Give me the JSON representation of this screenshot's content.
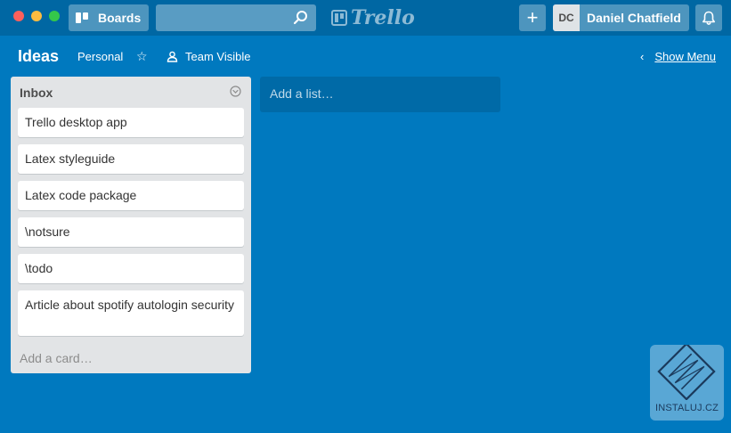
{
  "header": {
    "boards_label": "Boards",
    "search_value": "",
    "logo_text": "Trello",
    "add_label": "+",
    "user_initials": "DC",
    "user_name": "Daniel Chatfield"
  },
  "board": {
    "title": "Ideas",
    "visibility_org": "Personal",
    "team_visible": "Team Visible",
    "show_menu": "Show Menu"
  },
  "list": {
    "title": "Inbox",
    "cards": [
      "Trello desktop app",
      "Latex styleguide",
      "Latex code package",
      "\\notsure",
      "\\todo",
      "Article about spotify autologin security"
    ],
    "add_card": "Add a card…"
  },
  "add_list": "Add a list…",
  "watermark": {
    "text": "INSTALUJ.CZ"
  },
  "colors": {
    "board_bg": "#0079bf",
    "header_bg": "#0067a3",
    "list_bg": "#e2e4e6"
  }
}
